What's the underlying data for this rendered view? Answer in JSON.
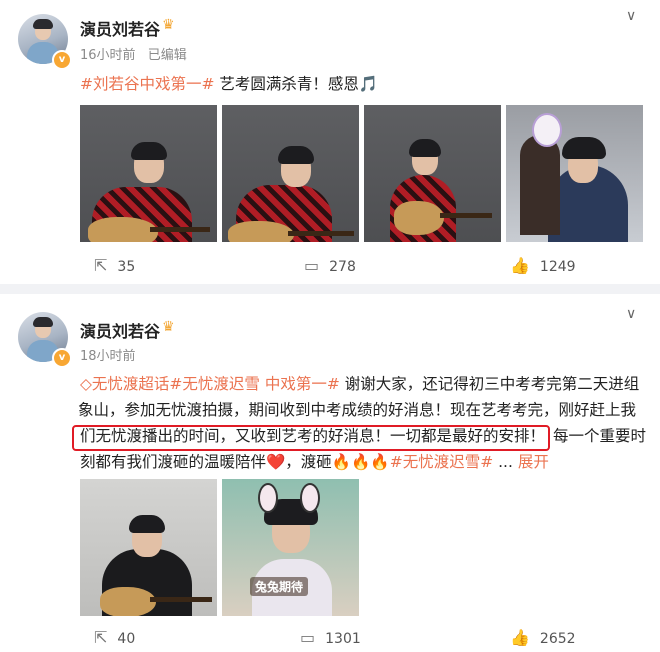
{
  "posts": [
    {
      "author": "演员刘若谷",
      "verified_badge": "v",
      "time": "16小时前",
      "edited": "已编辑",
      "hashtag": "#刘若谷中戏第一#",
      "text": " 艺考圆满杀青！感恩",
      "emoji": "🎵",
      "actions": {
        "share": "35",
        "comment": "278",
        "like": "1249"
      }
    },
    {
      "author": "演员刘若谷",
      "verified_badge": "v",
      "time": "18小时前",
      "topic1": "◇无忧渡超话",
      "topic2": "#无忧渡迟雪 中戏第一#",
      "text_a": " 谢谢大家，还记得初三中考考完第二天进组",
      "text_b": "象山，参加无忧渡拍摄，期间收到中考成绩的好消息！现在艺考考完，刚好赶上我",
      "text_c": "们无忧渡播出的时间，又收到艺考的好消息！一切都是最好的安排！",
      "text_c2": "每一个重要时",
      "text_d": "刻都有我们渡砸的温暖陪伴❤️，渡砸🔥🔥🔥",
      "hashtag2": "#无忧渡迟雪#",
      "ellipsis": " ...",
      "expand": "展开",
      "sticker_text": "兔兔期待",
      "actions": {
        "share": "40",
        "comment": "1301",
        "like": "2652"
      }
    }
  ],
  "icons": {
    "share": "share-icon",
    "comment": "comment-icon",
    "like": "like-icon",
    "menu": "chevron-down-icon"
  },
  "colors": {
    "accent": "#eb7350",
    "highlight": "#e01b25",
    "background": "#f1f2f5"
  }
}
